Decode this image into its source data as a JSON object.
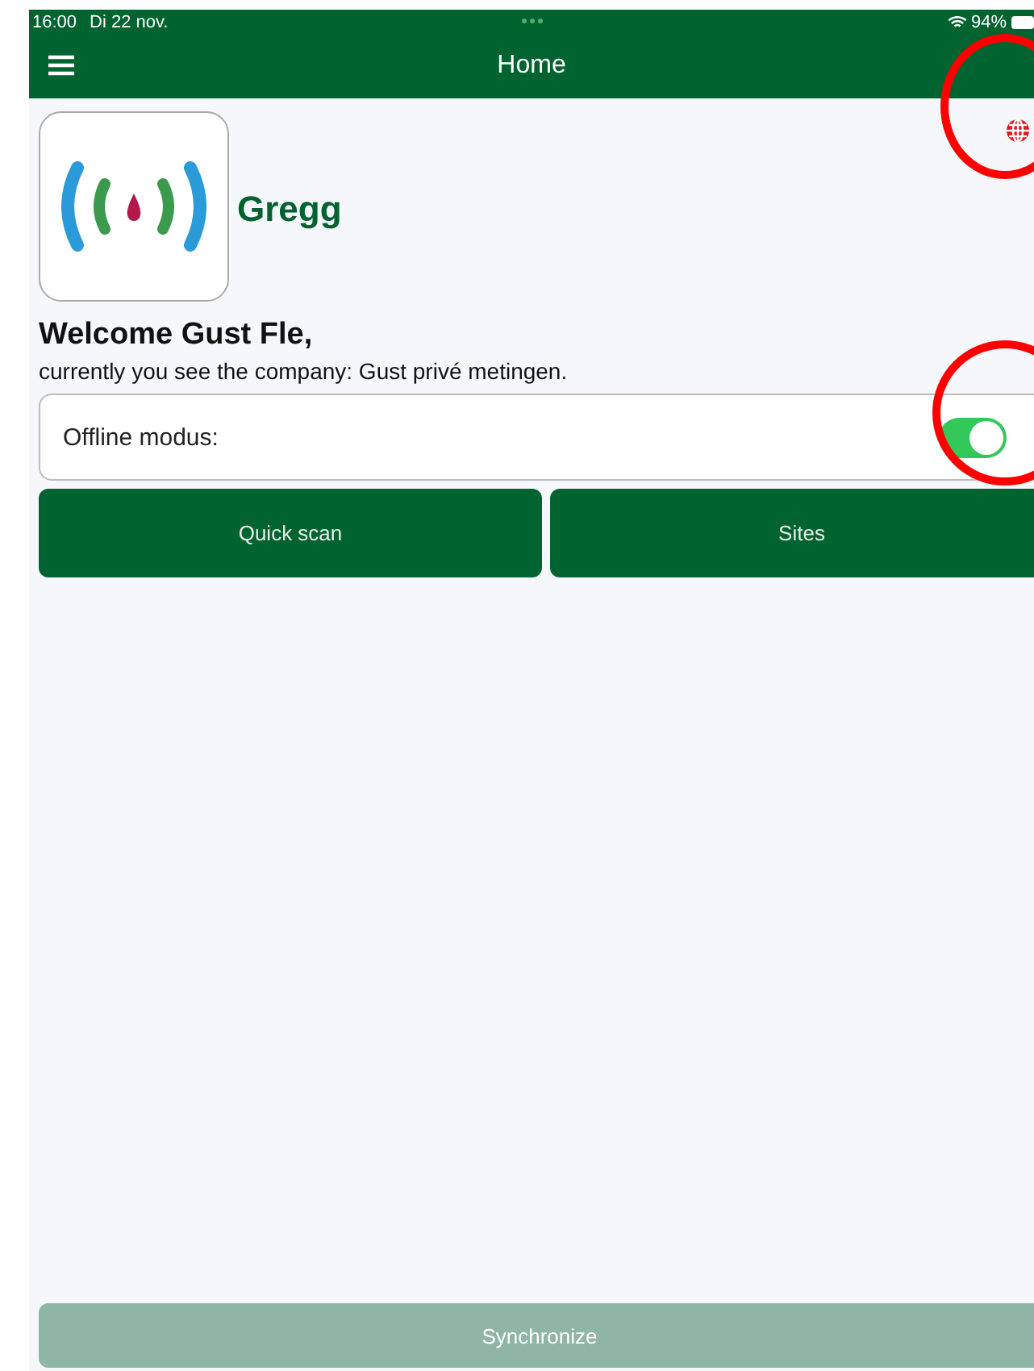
{
  "status_bar": {
    "time": "16:00",
    "date": "Di 22 nov.",
    "battery": "94%"
  },
  "nav_bar": {
    "title": "Home"
  },
  "company": {
    "name": "Gregg"
  },
  "welcome": {
    "title": "Welcome Gust Fle,",
    "subtitle": "currently you see the company: Gust privé metingen."
  },
  "offline": {
    "label": "Offline modus:",
    "on": true
  },
  "buttons": [
    {
      "label": "Quick scan",
      "disabled": false
    },
    {
      "label": "Sites",
      "disabled": false
    }
  ],
  "sync_button": {
    "label": "Synchronize",
    "disabled": true
  }
}
